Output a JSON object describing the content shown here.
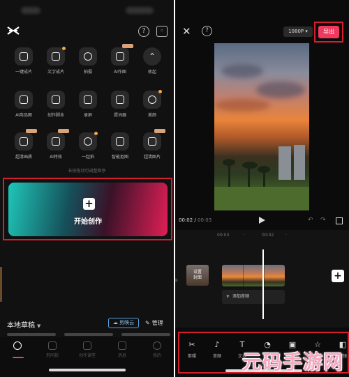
{
  "left": {
    "tools": [
      {
        "label": "一键成片",
        "icon": "play-square-icon"
      },
      {
        "label": "文字成片",
        "icon": "text-ai-icon"
      },
      {
        "label": "拍摄",
        "icon": "camera-icon"
      },
      {
        "label": "AI作图",
        "icon": "ai-image-icon"
      },
      {
        "label": "收起",
        "icon": "chevron-up-icon"
      },
      {
        "label": "AI商品图",
        "icon": "product-image-icon"
      },
      {
        "label": "创作脚本",
        "icon": "script-icon"
      },
      {
        "label": "录屏",
        "icon": "screen-record-icon"
      },
      {
        "label": "提词器",
        "icon": "teleprompter-icon"
      },
      {
        "label": "美颜",
        "icon": "beauty-icon"
      },
      {
        "label": "超清画质",
        "icon": "hd-quality-icon"
      },
      {
        "label": "AI特效",
        "icon": "ai-effect-icon"
      },
      {
        "label": "一起拍",
        "icon": "co-shoot-icon"
      },
      {
        "label": "智能抠图",
        "icon": "smart-cutout-icon"
      },
      {
        "label": "超清图片",
        "icon": "hd-image-icon"
      }
    ],
    "hint": "长按拖动可调整顺序",
    "create_label": "开始创作",
    "drafts_label": "本地草稿",
    "cloud_label": "剪映云",
    "manage_label": "管理",
    "tabs": [
      "剪辑",
      "剪同款",
      "创作课堂",
      "消息",
      "我的"
    ]
  },
  "right": {
    "resolution": "1080P",
    "export_label": "导出",
    "current_time": "00:02",
    "total_time": "00:03",
    "ruler": [
      "00:00",
      "·",
      "00:02",
      "·"
    ],
    "cover_label": "设置\n封面",
    "side_label": "声",
    "add_audio_label": "添加音频",
    "toolbar": [
      {
        "label": "剪辑",
        "icon": "scissors-icon"
      },
      {
        "label": "音频",
        "icon": "music-note-icon"
      },
      {
        "label": "文本",
        "icon": "text-icon"
      },
      {
        "label": "贴纸",
        "icon": "sticker-icon"
      },
      {
        "label": "画中画",
        "icon": "picture-in-picture-icon"
      },
      {
        "label": "特效",
        "icon": "effect-star-icon"
      },
      {
        "label": "滤镜",
        "icon": "filter-icon"
      }
    ]
  },
  "watermark": "元码手游网"
}
